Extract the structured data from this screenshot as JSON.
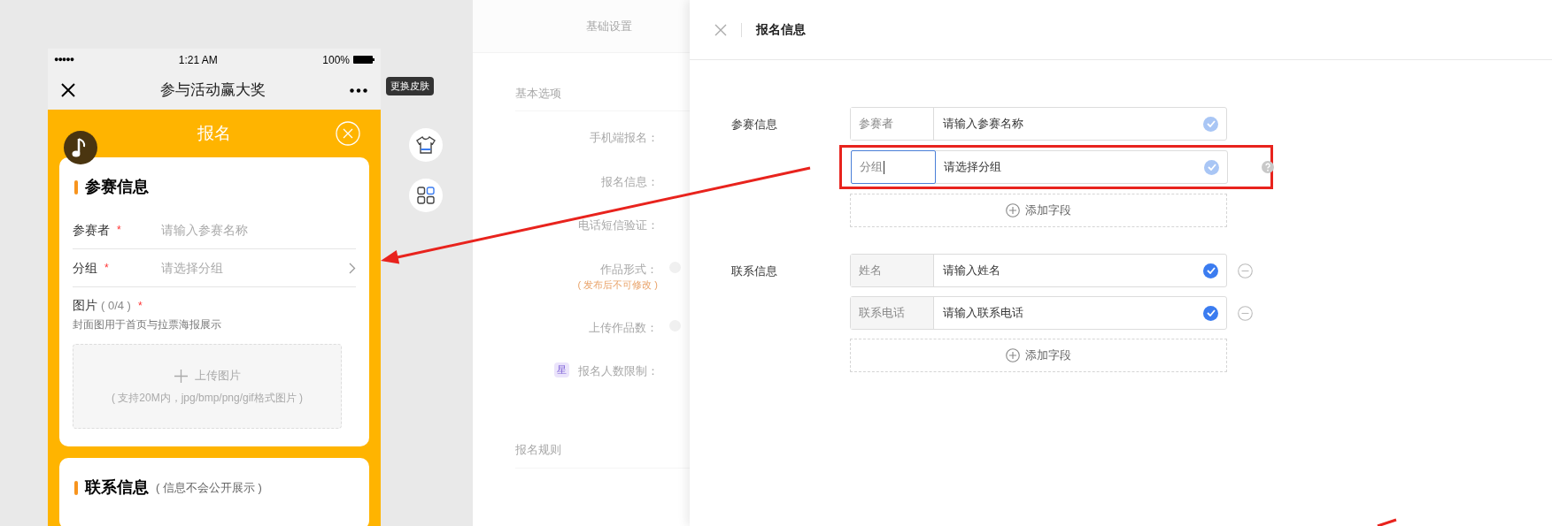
{
  "phone": {
    "status_bar": {
      "signal": "●●●●●",
      "time": "1:21 AM",
      "battery": "100%"
    },
    "nav": {
      "title": "参与活动赢大奖"
    },
    "header": {
      "title": "报名"
    },
    "sections": [
      {
        "title": "参赛信息",
        "fields": [
          {
            "kind": "text",
            "label": "参赛者",
            "required_mark": "*",
            "placeholder": "请输入参赛名称"
          },
          {
            "kind": "select",
            "label": "分组",
            "required_mark": "*",
            "placeholder": "请选择分组"
          },
          {
            "kind": "image",
            "label": "图片",
            "count": "( 0/4 )",
            "required_mark": "*",
            "hint": "封面图用于首页与拉票海报展示",
            "upload_label": "上传图片",
            "upload_hint": "( 支持20M内，jpg/bmp/png/gif格式图片 )"
          }
        ]
      },
      {
        "title": "联系信息",
        "note": "( 信息不会公开展示 )"
      }
    ]
  },
  "side_tools": {
    "tooltip": "更换皮肤"
  },
  "settings": {
    "tab": "基础设置",
    "groups": [
      {
        "title": "基本选项",
        "items": [
          {
            "label": "手机端报名："
          },
          {
            "label": "报名信息："
          },
          {
            "label": "电话短信验证："
          },
          {
            "label": "作品形式：",
            "help": true,
            "note": "( 发布后不可修改 )"
          },
          {
            "label": "上传作品数：",
            "help": true
          },
          {
            "label": "报名人数限制：",
            "badge": "星"
          }
        ]
      },
      {
        "title": "报名规则"
      }
    ]
  },
  "drawer": {
    "title": "报名信息",
    "sections": [
      {
        "label": "参赛信息",
        "add_label": "添加字段",
        "rows": [
          {
            "label": "参赛者",
            "hint_text": "请输入参赛名称",
            "checked": true,
            "disabled": true,
            "focused": false,
            "help": false,
            "highlighted": false
          },
          {
            "label": "分组",
            "hint_text": "请选择分组",
            "checked": true,
            "disabled": true,
            "focused": true,
            "help": true,
            "highlighted": true
          }
        ]
      },
      {
        "label": "联系信息",
        "add_label": "添加字段",
        "rows": [
          {
            "label": "姓名",
            "hint_text": "请输入姓名",
            "checked": true,
            "disabled": false,
            "focused": false,
            "help": false,
            "highlighted": false
          },
          {
            "label": "联系电话",
            "hint_text": "请输入联系电话",
            "checked": true,
            "disabled": false,
            "focused": false,
            "help": false,
            "highlighted": false
          }
        ]
      }
    ]
  }
}
